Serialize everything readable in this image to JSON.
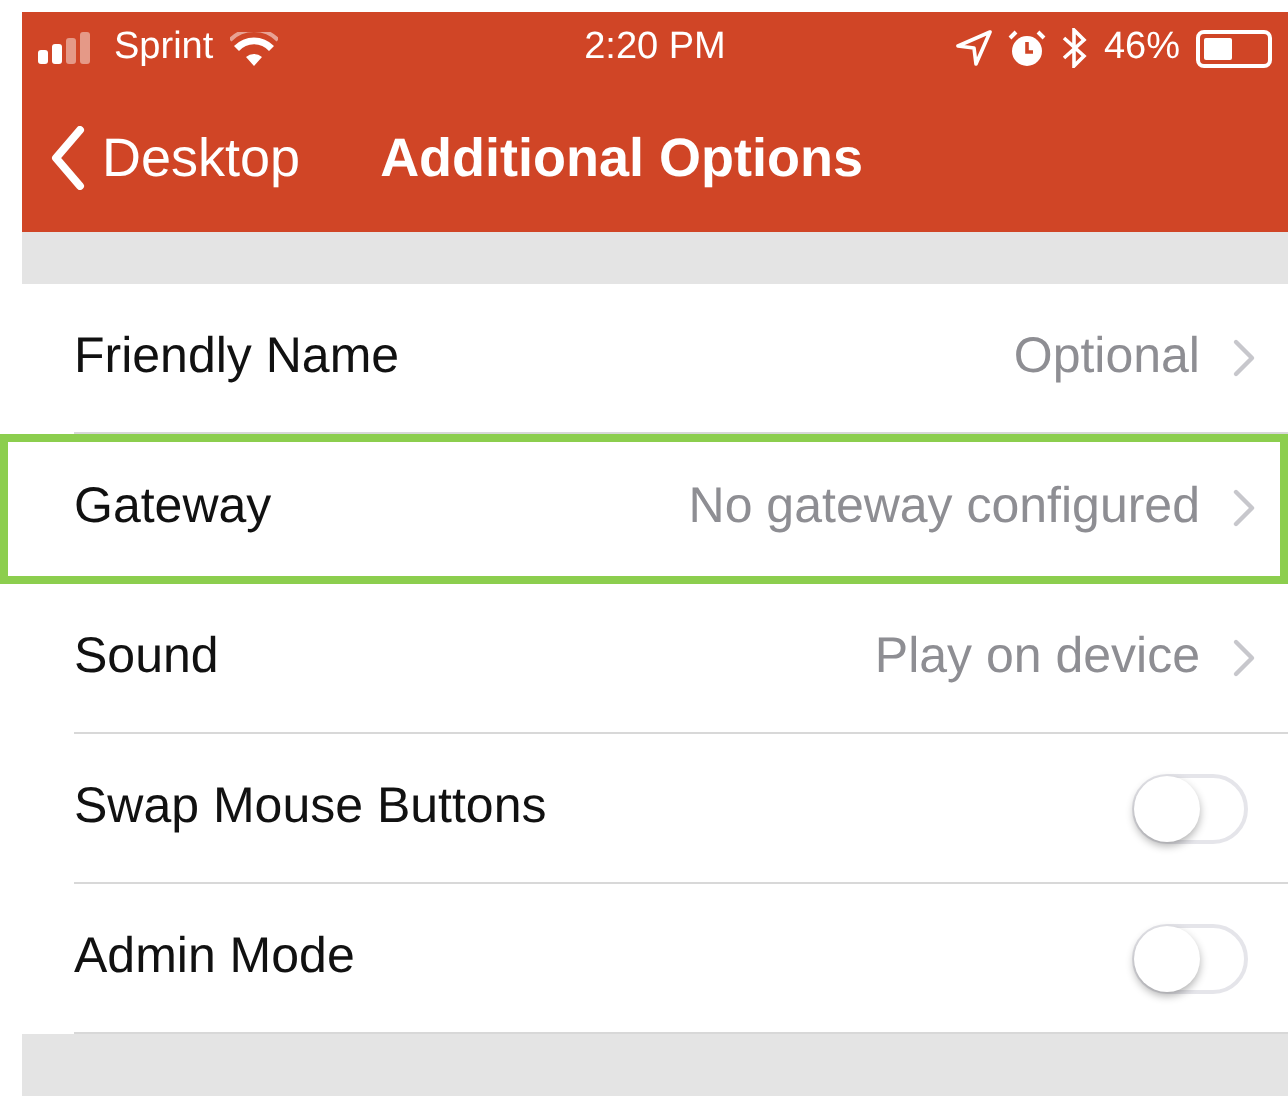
{
  "status_bar": {
    "carrier": "Sprint",
    "time": "2:20 PM",
    "battery": "46%"
  },
  "nav": {
    "back": "Desktop",
    "title": "Additional Options"
  },
  "rows": [
    {
      "kind": "disclosure",
      "label": "Friendly Name",
      "value": "Optional",
      "highlighted": false
    },
    {
      "kind": "disclosure",
      "label": "Gateway",
      "value": "No gateway configured",
      "highlighted": true
    },
    {
      "kind": "disclosure",
      "label": "Sound",
      "value": "Play on device",
      "highlighted": false
    },
    {
      "kind": "toggle",
      "label": "Swap Mouse Buttons",
      "on": false
    },
    {
      "kind": "toggle",
      "label": "Admin Mode",
      "on": false
    }
  ]
}
